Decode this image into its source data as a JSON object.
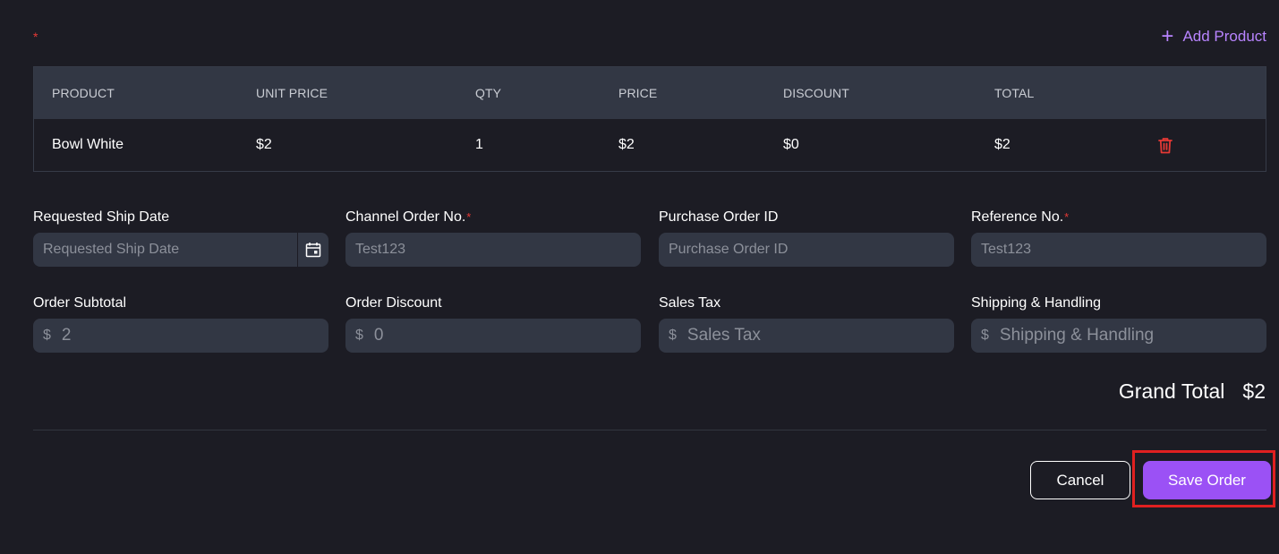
{
  "header": {
    "required_marker": "*",
    "add_product_icon": "plus-icon",
    "add_product_label": "Add Product"
  },
  "table": {
    "columns": [
      "PRODUCT",
      "UNIT PRICE",
      "QTY",
      "PRICE",
      "DISCOUNT",
      "TOTAL"
    ],
    "rows": [
      {
        "product": "Bowl White",
        "unit_price": "$2",
        "qty": "1",
        "price": "$2",
        "discount": "$0",
        "total": "$2",
        "action_icon": "trash-icon"
      }
    ]
  },
  "fields": {
    "requested_ship_date": {
      "label": "Requested Ship Date",
      "placeholder": "Requested Ship Date",
      "value": "",
      "icon": "calendar-icon"
    },
    "channel_order_no": {
      "label": "Channel Order No.",
      "required": "*",
      "placeholder": "Test123",
      "value": ""
    },
    "purchase_order_id": {
      "label": "Purchase Order ID",
      "placeholder": "Purchase Order ID",
      "value": ""
    },
    "reference_no": {
      "label": "Reference No.",
      "required": "*",
      "placeholder": "Test123",
      "value": ""
    },
    "order_subtotal": {
      "label": "Order Subtotal",
      "currency": "$",
      "placeholder": "2",
      "value": ""
    },
    "order_discount": {
      "label": "Order Discount",
      "currency": "$",
      "placeholder": "0",
      "value": ""
    },
    "sales_tax": {
      "label": "Sales Tax",
      "currency": "$",
      "placeholder": "Sales Tax",
      "value": ""
    },
    "shipping_handling": {
      "label": "Shipping & Handling",
      "currency": "$",
      "placeholder": "Shipping & Handling",
      "value": ""
    }
  },
  "summary": {
    "grand_total_label": "Grand Total",
    "grand_total_value": "$2"
  },
  "actions": {
    "cancel_label": "Cancel",
    "save_label": "Save Order"
  },
  "colors": {
    "background": "#1c1c24",
    "surface": "#323744",
    "accent": "#9b51f5",
    "accent_text": "#b884ff",
    "danger": "#e53935"
  }
}
